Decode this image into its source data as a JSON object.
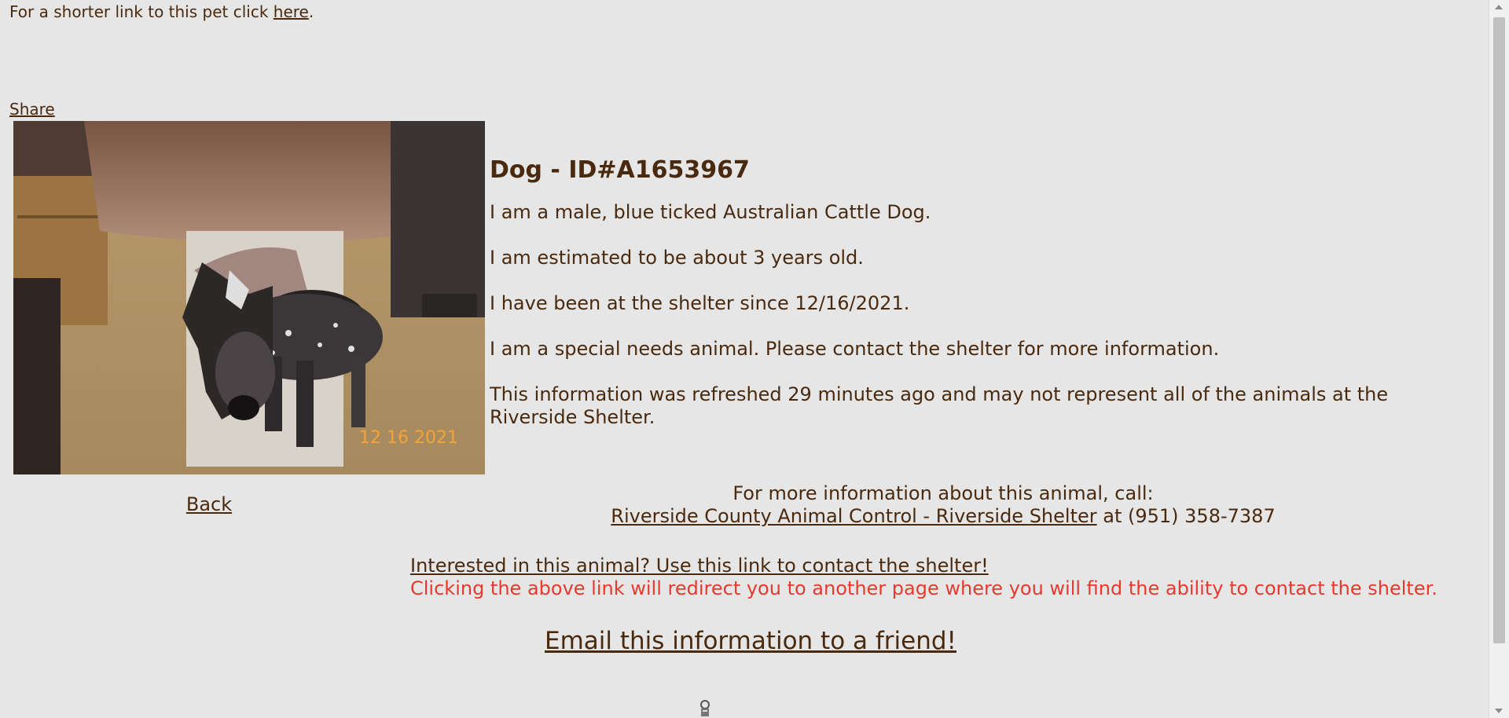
{
  "top": {
    "shortlink_prefix": "For a shorter link to this pet click ",
    "shortlink_link": "here",
    "shortlink_suffix": "."
  },
  "share_label": "Share",
  "photo": {
    "date_stamp": "12 16 2021"
  },
  "back_label": "Back",
  "animal": {
    "title": "Dog - ID#A1653967",
    "lines": [
      "I am a male, blue ticked Australian Cattle Dog.",
      "I am estimated to be about 3 years old.",
      "I have been at the shelter since 12/16/2021.",
      "I am a special needs animal. Please contact the shelter for more information.",
      "This information was refreshed 29 minutes ago and may not represent all of the animals at the Riverside Shelter."
    ]
  },
  "contact": {
    "call_text": "For more information about this animal, call:",
    "shelter_link": "Riverside County Animal Control - Riverside Shelter",
    "phone_text": " at (951) 358-7387",
    "interested_link": "Interested in this animal? Use this link to contact the shelter!",
    "redirect_note": "Clicking the above link will redirect you to another page where you will find the ability to contact the shelter.",
    "email_link": "Email this information to a friend!"
  },
  "colors": {
    "text": "#4a2a0f",
    "background": "#e6e6e6",
    "note": "#e53a2f"
  }
}
